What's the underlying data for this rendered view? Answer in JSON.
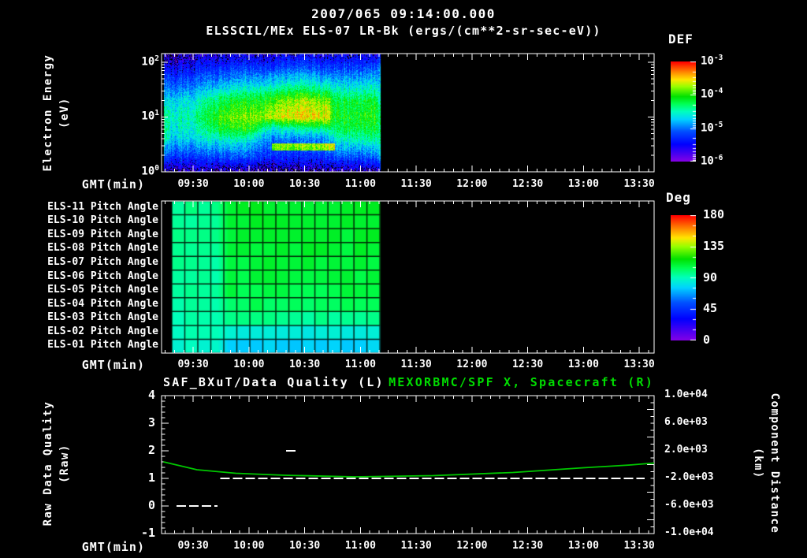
{
  "header": {
    "title": "2007/065 09:14:00.000",
    "subtitle": "ELSSCIL/MEx ELS-07 LR-Bk  (ergs/(cm**2-sr-sec-eV))"
  },
  "time_axis": {
    "label": "GMT(min)",
    "start_min": 553,
    "end_min": 818,
    "minor_step_min": 5,
    "ticks": [
      {
        "label": "09:30",
        "min": 570
      },
      {
        "label": "10:00",
        "min": 600
      },
      {
        "label": "10:30",
        "min": 630
      },
      {
        "label": "11:00",
        "min": 660
      },
      {
        "label": "11:30",
        "min": 690
      },
      {
        "label": "12:00",
        "min": 720
      },
      {
        "label": "12:30",
        "min": 750
      },
      {
        "label": "13:00",
        "min": 780
      },
      {
        "label": "13:30",
        "min": 810
      }
    ]
  },
  "panels": {
    "spectrogram": {
      "y_label_line1": "Electron Energy",
      "y_label_line2": "(eV)",
      "y_tick_exponents": [
        "2",
        "1",
        "0"
      ],
      "colorbar": {
        "title": "DEF",
        "tick_exponents": [
          "-3",
          "-4",
          "-5",
          "-6"
        ]
      }
    },
    "pitch": {
      "row_labels": [
        "ELS-11 Pitch Angle",
        "ELS-10 Pitch Angle",
        "ELS-09 Pitch Angle",
        "ELS-08 Pitch Angle",
        "ELS-07 Pitch Angle",
        "ELS-06 Pitch Angle",
        "ELS-05 Pitch Angle",
        "ELS-04 Pitch Angle",
        "ELS-03 Pitch Angle",
        "ELS-02 Pitch Angle",
        "ELS-01 Pitch Angle"
      ],
      "colorbar": {
        "title": "Deg",
        "tick_labels": [
          "180",
          "135",
          "90",
          "45",
          "0"
        ]
      }
    },
    "quality": {
      "title_left": "SAF_BXuT/Data Quality (L)",
      "title_right": "MEXORBMC/SPF X, Spacecraft (R)",
      "left_axis": {
        "line1": "Raw Data Quality",
        "line2": "(Raw)",
        "tick_labels": [
          "4",
          "3",
          "2",
          "1",
          "0",
          "-1"
        ]
      },
      "right_axis": {
        "line1": "Component Distance",
        "line2": "(km)",
        "tick_labels": [
          "1.0e+04",
          "6.0e+03",
          "2.0e+03",
          "-2.0e+03",
          "-6.0e+03",
          "-1.0e+04"
        ]
      }
    }
  },
  "colors": {
    "background": "#000000",
    "text": "#ffffff",
    "title_green": "#00dc00",
    "curve_green": "#00c800",
    "quality_white": "#ffffff"
  },
  "colormap": {
    "stops": [
      [
        0,
        130,
        0,
        230
      ],
      [
        0.17,
        0,
        0,
        255
      ],
      [
        0.3,
        0,
        80,
        255
      ],
      [
        0.42,
        0,
        210,
        255
      ],
      [
        0.5,
        0,
        255,
        190
      ],
      [
        0.58,
        0,
        255,
        80
      ],
      [
        0.65,
        0,
        225,
        0
      ],
      [
        0.75,
        150,
        255,
        0
      ],
      [
        0.82,
        255,
        230,
        0
      ],
      [
        0.9,
        255,
        130,
        0
      ],
      [
        1,
        255,
        0,
        0
      ]
    ]
  },
  "chart_data": [
    {
      "type": "heatmap",
      "title": "ELSSCIL/MEx ELS-07 LR-Bk electron energy spectrogram",
      "xlabel": "GMT(min)",
      "ylabel": "Electron Energy (eV)",
      "y_scale": "log",
      "y_range_ev": [
        1,
        140
      ],
      "colorbar": {
        "title": "DEF",
        "units": "ergs/(cm**2-sr-sec-eV)",
        "range_log10": [
          -6,
          -3
        ]
      },
      "data_time_range": [
        "09:14",
        "11:10"
      ],
      "t_nodes_min": [
        554,
        558,
        572,
        586,
        600,
        614,
        628,
        642,
        646,
        652,
        660,
        668,
        670
      ],
      "log10_energy_nodes": [
        0,
        0.3,
        0.6,
        0.8,
        1.0,
        1.3,
        1.6,
        1.9,
        2.15
      ],
      "log10_def": [
        [
          -5.8,
          -5.0,
          -4.4,
          -4.3,
          -4.3,
          -4.6,
          -5.0,
          -5.4,
          -5.7
        ],
        [
          -5.8,
          -5.2,
          -4.7,
          -4.6,
          -4.5,
          -4.7,
          -5.1,
          -5.5,
          -5.8
        ],
        [
          -5.8,
          -5.2,
          -4.7,
          -4.5,
          -4.4,
          -4.6,
          -5.0,
          -5.4,
          -5.7
        ],
        [
          -5.8,
          -5.1,
          -4.5,
          -4.1,
          -3.9,
          -4.2,
          -4.8,
          -5.3,
          -5.6
        ],
        [
          -5.8,
          -5.1,
          -4.6,
          -4.0,
          -3.8,
          -4.1,
          -4.7,
          -5.2,
          -5.6
        ],
        [
          -5.8,
          -5.3,
          -5.0,
          -4.6,
          -3.65,
          -3.9,
          -4.6,
          -5.2,
          -5.6
        ],
        [
          -5.8,
          -5.3,
          -5.0,
          -4.4,
          -3.5,
          -3.7,
          -4.5,
          -5.1,
          -5.5
        ],
        [
          -5.8,
          -5.2,
          -4.9,
          -4.3,
          -3.55,
          -3.8,
          -4.6,
          -5.2,
          -5.6
        ],
        [
          -5.8,
          -5.1,
          -4.6,
          -4.3,
          -4.1,
          -4.2,
          -4.7,
          -5.2,
          -5.6
        ],
        [
          -5.8,
          -5.1,
          -4.5,
          -4.2,
          -4.1,
          -4.2,
          -4.7,
          -5.2,
          -5.6
        ],
        [
          -5.8,
          -5.1,
          -4.5,
          -4.2,
          -4.1,
          -4.2,
          -4.7,
          -5.2,
          -5.6
        ],
        [
          -5.8,
          -5.0,
          -4.4,
          -4.1,
          -4.0,
          -4.1,
          -4.6,
          -5.1,
          -5.6
        ],
        [
          -5.7,
          -4.9,
          -4.5,
          -4.4,
          -4.4,
          -4.5,
          -4.8,
          -5.0,
          -5.5
        ]
      ],
      "features": [
        {
          "t_min": [
            612,
            646
          ],
          "log10_e": [
            0.4,
            0.52
          ],
          "boost": 1.3
        }
      ]
    },
    {
      "type": "heatmap",
      "title": "ELS pitch angle grid",
      "units": "deg",
      "rows": [
        "ELS-11",
        "ELS-10",
        "ELS-09",
        "ELS-08",
        "ELS-07",
        "ELS-06",
        "ELS-05",
        "ELS-04",
        "ELS-03",
        "ELS-02",
        "ELS-01"
      ],
      "colorbar": {
        "title": "Deg",
        "range": [
          0,
          180
        ]
      },
      "data_time_range_min": [
        558,
        670
      ],
      "column_width_min": 7,
      "segments": [
        {
          "t_min": [
            558,
            586
          ],
          "angles_deg": [
            97,
            96,
            96,
            95,
            95,
            94,
            94,
            93,
            92,
            90,
            88
          ]
        },
        {
          "t_min": [
            586,
            670
          ],
          "angles_deg": [
            111,
            110,
            110,
            109,
            108,
            107,
            106,
            103,
            96,
            84,
            76
          ]
        }
      ]
    },
    {
      "type": "line",
      "title_left": "SAF_BXuT/Data Quality (L)",
      "title_right": "MEXORBMC/SPF X, Spacecraft (R)",
      "ylim_left": [
        -1,
        4
      ],
      "ylim_right": [
        -10000,
        10000
      ],
      "series": [
        {
          "name": "SAF_BXuT/Data Quality",
          "axis": "left",
          "style": "dashed",
          "color": "#ffffff",
          "segments": [
            {
              "value": 0,
              "t_min": [
                561,
                583
              ]
            },
            {
              "value": 1,
              "t_min": [
                584.5,
                813
              ]
            },
            {
              "value": 2,
              "t_min": [
                620,
                625
              ]
            }
          ]
        },
        {
          "name": "MEXORBMC/SPF X Spacecraft",
          "axis": "right",
          "style": "solid",
          "color": "#00c800",
          "points_min_km": [
            [
              554,
              400
            ],
            [
              572,
              -740
            ],
            [
              593,
              -1260
            ],
            [
              619,
              -1540
            ],
            [
              657,
              -1770
            ],
            [
              699,
              -1600
            ],
            [
              742,
              -1140
            ],
            [
              780,
              -460
            ],
            [
              805,
              -60
            ],
            [
              818,
              230
            ]
          ]
        }
      ]
    }
  ]
}
